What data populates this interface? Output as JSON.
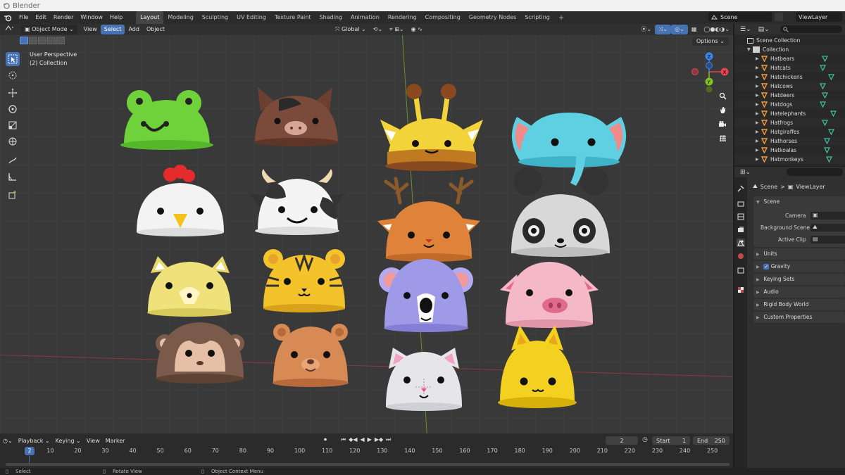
{
  "window": {
    "title": "Blender"
  },
  "menu": [
    "File",
    "Edit",
    "Render",
    "Window",
    "Help"
  ],
  "workspaces": [
    "Layout",
    "Modeling",
    "Sculpting",
    "UV Editing",
    "Texture Paint",
    "Shading",
    "Animation",
    "Rendering",
    "Compositing",
    "Geometry Nodes",
    "Scripting"
  ],
  "workspace_add": "+",
  "active_workspace": "Layout",
  "scene_name": "Scene",
  "view_layer": "ViewLayer",
  "viewport": {
    "mode": "Object Mode",
    "menus": [
      "View",
      "Select",
      "Add",
      "Object"
    ],
    "active_menu": "Select",
    "transform_orientation": "Global",
    "options_label": "Options",
    "perspective_label": "User Perspective",
    "collection_label": "(2) Collection",
    "gizmo_axes": [
      "X",
      "Y",
      "Z"
    ]
  },
  "hats": [
    {
      "name": "frog",
      "color": "#6fd23a"
    },
    {
      "name": "horse",
      "color": "#7a4a3a"
    },
    {
      "name": "giraffe",
      "color": "#f2d33a"
    },
    {
      "name": "elephant",
      "color": "#5fd0e2"
    },
    {
      "name": "chicken",
      "color": "#f3f3f3"
    },
    {
      "name": "cow",
      "color": "#f4f4f4"
    },
    {
      "name": "deer",
      "color": "#e0833a"
    },
    {
      "name": "panda",
      "color": "#d8d8d8"
    },
    {
      "name": "dog",
      "color": "#efe27a"
    },
    {
      "name": "tiger",
      "color": "#f4c22a"
    },
    {
      "name": "koala",
      "color": "#9f9ae8"
    },
    {
      "name": "pig",
      "color": "#f4b8c6"
    },
    {
      "name": "monkey",
      "color": "#7a5a4a"
    },
    {
      "name": "bear",
      "color": "#d88a55"
    },
    {
      "name": "cat",
      "color": "#e6e6ea"
    },
    {
      "name": "yellow-cat",
      "color": "#f4d020"
    }
  ],
  "outliner": {
    "root": "Scene Collection",
    "collection": "Collection",
    "items": [
      "Hatbears",
      "Hatcats",
      "Hatchickens",
      "Hatcows",
      "Hatdeers",
      "Hatdogs",
      "Hatelephants",
      "Hatfrogs",
      "Hatgiraffes",
      "Hathorses",
      "Hatkoalas",
      "Hatmonkeys"
    ]
  },
  "properties": {
    "breadcrumb_scene": "Scene",
    "breadcrumb_sep": ">",
    "breadcrumb_layer": "ViewLayer",
    "scene_panel": "Scene",
    "camera_label": "Camera",
    "background_label": "Background Scene",
    "clip_label": "Active Clip",
    "panels": [
      "Units",
      "Gravity",
      "Keying Sets",
      "Audio",
      "Rigid Body World",
      "Custom Properties"
    ]
  },
  "timeline": {
    "menus": [
      "Playback",
      "Keying",
      "View",
      "Marker"
    ],
    "current_frame": "2",
    "start_label": "Start",
    "start": "1",
    "end_label": "End",
    "end": "250",
    "ruler": [
      "10",
      "20",
      "30",
      "40",
      "50",
      "60",
      "70",
      "80",
      "90",
      "100",
      "110",
      "120",
      "130",
      "140",
      "150",
      "160",
      "170",
      "180",
      "190",
      "200",
      "210",
      "220",
      "230",
      "240",
      "250"
    ]
  },
  "status": [
    "Select",
    "Rotate View",
    "Object Context Menu"
  ],
  "colors": {
    "accent": "#4772b3",
    "x_axis": "#e54451",
    "y_axis": "#84c11f",
    "z_axis": "#3a86e6"
  }
}
